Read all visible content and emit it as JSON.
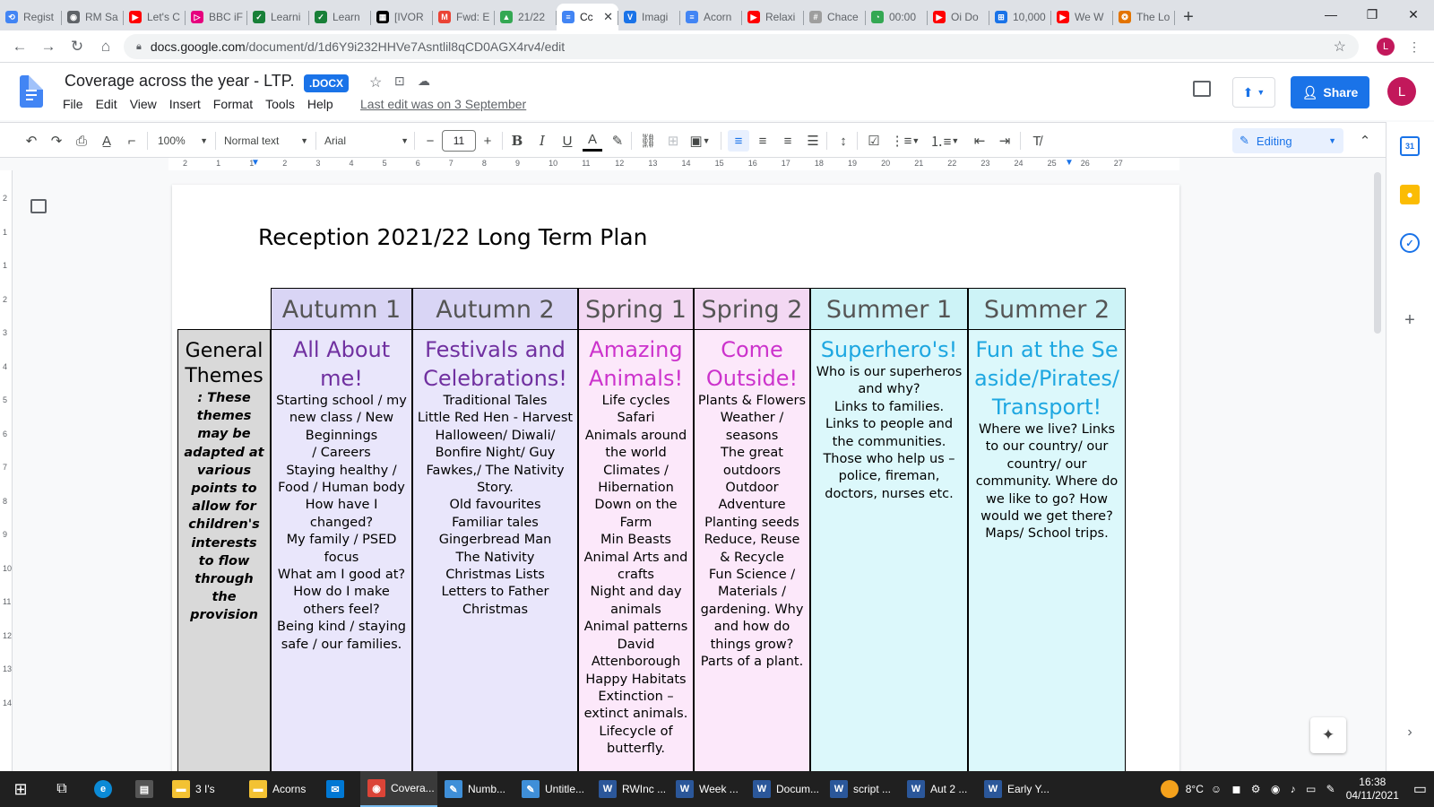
{
  "browser": {
    "tabs": [
      {
        "label": "Regist",
        "color": "#4285f4",
        "glyph": "⟲"
      },
      {
        "label": "RM Sa",
        "color": "#5f6368",
        "glyph": "◉"
      },
      {
        "label": "Let's C",
        "color": "#ff0000",
        "glyph": "▶"
      },
      {
        "label": "BBC iF",
        "color": "#e6007e",
        "glyph": "▷"
      },
      {
        "label": "Learni",
        "color": "#188038",
        "glyph": "✓"
      },
      {
        "label": "Learn",
        "color": "#188038",
        "glyph": "✓"
      },
      {
        "label": "[IVOR",
        "color": "#000000",
        "glyph": "▦"
      },
      {
        "label": "Fwd: E",
        "color": "#ea4335",
        "glyph": "M"
      },
      {
        "label": "21/22",
        "color": "#34a853",
        "glyph": "▲"
      },
      {
        "label": "Cc",
        "color": "#4285f4",
        "glyph": "≡"
      },
      {
        "label": "Imagi",
        "color": "#1a73e8",
        "glyph": "V"
      },
      {
        "label": "Acorn",
        "color": "#4285f4",
        "glyph": "≡"
      },
      {
        "label": "Relaxi",
        "color": "#ff0000",
        "glyph": "▶"
      },
      {
        "label": "Chace",
        "color": "#9e9e9e",
        "glyph": "#"
      },
      {
        "label": "00:00",
        "color": "#34a853",
        "glyph": "◔"
      },
      {
        "label": "Oi Do",
        "color": "#ff0000",
        "glyph": "▶"
      },
      {
        "label": "10,000",
        "color": "#1a73e8",
        "glyph": "⊞"
      },
      {
        "label": "We W",
        "color": "#ff0000",
        "glyph": "▶"
      },
      {
        "label": "The Lo",
        "color": "#e37400",
        "glyph": "❂"
      }
    ],
    "active_tab": 9,
    "new_tab": "+",
    "url_host": "docs.google.com",
    "url_path": "/document/d/1d6Y9i232HHVe7Asntlil8qCD0AGX4rv4/edit",
    "profile_initial": "L"
  },
  "docs": {
    "title": "Coverage across the year - LTP.",
    "badge": ".DOCX",
    "menu": [
      "File",
      "Edit",
      "View",
      "Insert",
      "Format",
      "Tools",
      "Help"
    ],
    "last_edit": "Last edit was on 3 September",
    "share_label": "Share",
    "avatar_initial": "L"
  },
  "toolbar": {
    "zoom": "100%",
    "style": "Normal text",
    "font": "Arial",
    "font_size": "11",
    "mode": "Editing"
  },
  "ruler": {
    "h_ticks": [
      "2",
      "1",
      "1",
      "2",
      "3",
      "4",
      "5",
      "6",
      "7",
      "8",
      "9",
      "10",
      "11",
      "12",
      "13",
      "14",
      "15",
      "16",
      "17",
      "18",
      "19",
      "20",
      "21",
      "22",
      "23",
      "24",
      "25",
      "26",
      "27"
    ],
    "v_ticks": [
      "2",
      "1",
      "1",
      "2",
      "3",
      "4",
      "5",
      "6",
      "7",
      "8",
      "9",
      "10",
      "11",
      "12",
      "13",
      "14"
    ]
  },
  "document": {
    "heading": "Reception 2021/22 Long Term Plan",
    "general_themes_title": "General Themes",
    "general_themes_note": ": These\nthemes\nmay be\nadapted at\nvarious\npoints to\nallow for\nchildren's\ninterests\nto flow\nthrough the\nprovision",
    "columns": [
      {
        "term": "Autumn 1",
        "theme": "All About me!",
        "color": "#7030a0",
        "bg": "#e9e6fb",
        "hbg": "#d9d5f5",
        "body": "Starting school / my new class / New Beginnings\n/ Careers\nStaying healthy / Food  / Human body\nHow have I changed?\nMy family / PSED focus\nWhat am I good at?\nHow do I make others feel?\nBeing kind / staying safe / our families."
      },
      {
        "term": "Autumn 2",
        "theme": "Festivals and Celebrations!",
        "color": "#7030a0",
        "bg": "#e9e6fb",
        "hbg": "#d9d5f5",
        "body": "Traditional Tales\nLittle Red Hen - Harvest\nHalloween/ Diwali/ Bonfire Night/ Guy Fawkes,/ The Nativity Story.\nOld favourites\nFamiliar tales\nGingerbread Man\nThe Nativity\nChristmas Lists\nLetters to Father Christmas"
      },
      {
        "term": "Spring 1",
        "theme": "Amazing Animals!",
        "color": "#cc33cc",
        "bg": "#fce8fa",
        "hbg": "#f3d8f3",
        "body": "Life cycles\nSafari\nAnimals around the world\nClimates / Hibernation\nDown on the Farm\nMin Beasts\nAnimal Arts and crafts\nNight and day animals\nAnimal patterns\nDavid Attenborough\nHappy Habitats\nExtinction – extinct animals.\nLifecycle of butterfly."
      },
      {
        "term": "Spring 2",
        "theme": "Come Outside!",
        "color": "#cc33cc",
        "bg": "#fce8fa",
        "hbg": "#f3d8f3",
        "body": "Plants & Flowers\nWeather / seasons\nThe great outdoors\nOutdoor Adventure\nPlanting seeds\nReduce, Reuse & Recycle\nFun Science / Materials / gardening. Why and how do things grow?\nParts of a plant."
      },
      {
        "term": "Summer 1",
        "theme": "Superhero's!",
        "color": "#1ea7e1",
        "bg": "#dcf8fb",
        "hbg": "#cdf3f7",
        "body": "Who is our superheros and why?\nLinks to families.\nLinks to people and the communities.\nThose who help us – police, fireman, doctors, nurses etc."
      },
      {
        "term": "Summer 2",
        "theme": "Fun at the Seaside/Pirates/Transport!",
        "color": "#1ea7e1",
        "bg": "#dcf8fb",
        "hbg": "#cdf3f7",
        "body": "Where we live? Links to our country/ our country/ our community. Where do we like to go? How would we get there? Maps/ School trips."
      }
    ]
  },
  "taskbar": {
    "items": [
      {
        "label": "3 I's",
        "icon": "folder-icon",
        "color": "#f3c233",
        "glyph": "▬"
      },
      {
        "label": "Acorns",
        "icon": "folder-icon",
        "color": "#f3c233",
        "glyph": "▬"
      },
      {
        "label": "",
        "icon": "mail-icon",
        "color": "#0078d4",
        "glyph": "✉"
      },
      {
        "label": "Covera...",
        "icon": "chrome-icon",
        "color": "#db4437",
        "glyph": "◉"
      },
      {
        "label": "Numb...",
        "icon": "notepad-icon",
        "color": "#3f8fd8",
        "glyph": "✎"
      },
      {
        "label": "Untitle...",
        "icon": "notepad-icon",
        "color": "#3f8fd8",
        "glyph": "✎"
      },
      {
        "label": "RWInc ...",
        "icon": "word-icon",
        "color": "#2b579a",
        "glyph": "W"
      },
      {
        "label": "Week ...",
        "icon": "word-icon",
        "color": "#2b579a",
        "glyph": "W"
      },
      {
        "label": "Docum...",
        "icon": "word-icon",
        "color": "#2b579a",
        "glyph": "W"
      },
      {
        "label": "script ...",
        "icon": "word-icon",
        "color": "#2b579a",
        "glyph": "W"
      },
      {
        "label": "Aut 2 ...",
        "icon": "word-icon",
        "color": "#2b579a",
        "glyph": "W"
      },
      {
        "label": "Early Y...",
        "icon": "word-icon",
        "color": "#2b579a",
        "glyph": "W"
      }
    ],
    "temperature": "8°C",
    "time": "16:38",
    "date": "04/11/2021"
  }
}
